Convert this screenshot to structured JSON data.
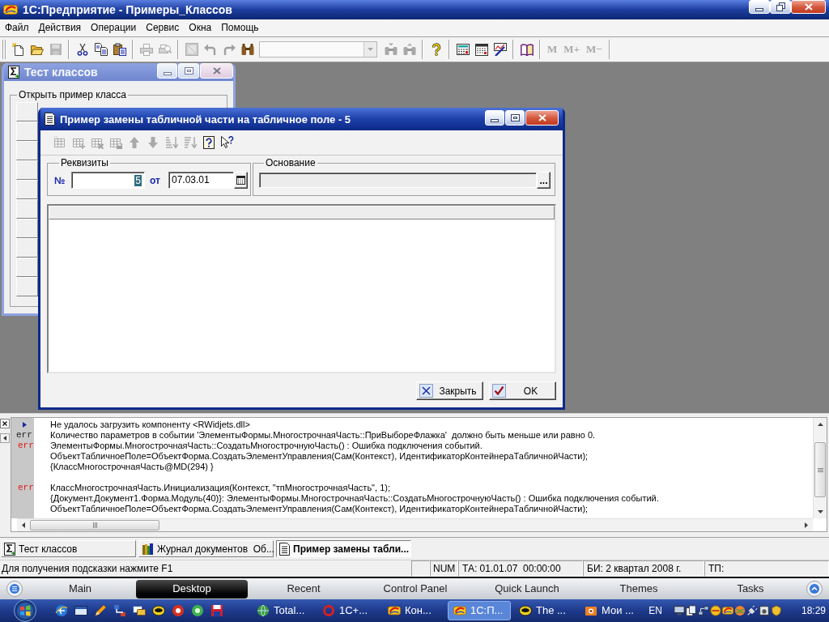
{
  "window": {
    "title": "1С:Предприятие - Примеры_Классов"
  },
  "menu": [
    "Файл",
    "Действия",
    "Операции",
    "Сервис",
    "Окна",
    "Помощь"
  ],
  "toolbar": [
    {
      "kind": "icon",
      "disabled": false
    },
    {
      "kind": "icon",
      "disabled": false
    },
    {
      "kind": "icon",
      "disabled": true
    },
    {
      "kind": "separator"
    },
    {
      "kind": "icon",
      "disabled": false
    },
    {
      "kind": "icon",
      "disabled": false
    },
    {
      "kind": "icon",
      "disabled": false
    },
    {
      "kind": "separator"
    },
    {
      "kind": "icon",
      "disabled": true
    },
    {
      "kind": "icon",
      "disabled": true
    },
    {
      "kind": "separator"
    },
    {
      "kind": "icon",
      "disabled": true
    },
    {
      "kind": "icon",
      "disabled": true
    },
    {
      "kind": "icon",
      "disabled": true
    },
    {
      "kind": "icon",
      "disabled": false
    },
    {
      "kind": "combo",
      "disabled": true
    },
    {
      "kind": "icon",
      "disabled": true
    },
    {
      "kind": "icon",
      "disabled": true
    },
    {
      "kind": "separator"
    },
    {
      "kind": "icon",
      "disabled": false
    },
    {
      "kind": "separator"
    },
    {
      "kind": "icon",
      "disabled": false
    },
    {
      "kind": "icon",
      "disabled": false
    },
    {
      "kind": "icon",
      "disabled": false
    },
    {
      "kind": "separator"
    },
    {
      "kind": "icon",
      "disabled": false
    },
    {
      "kind": "separator"
    },
    {
      "kind": "text",
      "label": "M",
      "disabled": true
    },
    {
      "kind": "text",
      "label": "M+",
      "disabled": true
    },
    {
      "kind": "text",
      "label": "M−",
      "disabled": true
    },
    {
      "kind": "separator"
    }
  ],
  "child_window": {
    "title": "Тест классов",
    "active": false,
    "group_title": "Открыть пример класса"
  },
  "dialog": {
    "title": "Пример замены табличной части на табличное поле - 5",
    "active": true,
    "toolbar": [
      {
        "disabled": true
      },
      {
        "disabled": true
      },
      {
        "disabled": true
      },
      {
        "disabled": true
      },
      {
        "disabled": true
      },
      {
        "disabled": true
      },
      {
        "disabled": true
      },
      {
        "disabled": true
      },
      {
        "disabled": false
      },
      {
        "disabled": false
      }
    ],
    "requisites": {
      "title": "Реквизиты",
      "number_label": "№",
      "number": "5",
      "number_selected": true,
      "date_label": "от",
      "date": "07.03.01"
    },
    "basis": {
      "title": "Основание",
      "button": "..."
    },
    "buttons": [
      {
        "kind": "close",
        "label": "Закрыть"
      },
      {
        "kind": "ok",
        "label": "OK"
      }
    ]
  },
  "messages": [
    {
      "lines": [
        {
          "kind": "info",
          "text": "Не удалось загрузить компоненту <RWidjets.dll>"
        },
        {
          "kind": "warning",
          "marker": "err",
          "text": "Количество параметров в событии 'ЭлементыФормы.МногострочнаяЧасть::ПриВыбореФлажка'  должно быть меньше или равно 0."
        },
        {
          "kind": "error",
          "marker": "err",
          "text": "ЭлементыФормы.МногострочнаяЧасть::СоздатьМногострочнуюЧасть() : Ошибка подключения событий."
        },
        {
          "kind": "text",
          "text": "ОбъектТабличноеПоле=ОбъектФорма.СоздатьЭлементУправления(Сам(Контекст), ИдентификаторКонтейнераТабличнойЧасти);"
        },
        {
          "kind": "text",
          "text": "{КлассМногострочнаяЧасть@MD(294) }"
        }
      ]
    },
    {
      "lines": [
        {
          "kind": "error",
          "marker": "err",
          "text": "КлассМногострочнаяЧасть.Инициализация(Контекст, \"тпМногострочнаяЧасть\", 1);"
        },
        {
          "kind": "text",
          "text": "{Документ.Документ1.Форма.Модуль(40)}: ЭлементыФормы.МногострочнаяЧасть::СоздатьМногострочнуюЧасть() : Ошибка подключения событий."
        },
        {
          "kind": "text",
          "text": "ОбъектТабличноеПоле=ОбъектФорма.СоздатьЭлементУправления(Сам(Контекст), ИдентификаторКонтейнераТабличнойЧасти);"
        }
      ]
    }
  ],
  "window_tabs": [
    {
      "kind": "processing",
      "label": "Тест классов",
      "selected": false
    },
    {
      "kind": "journal",
      "label": "Журнал документов  Об...",
      "selected": false
    },
    {
      "kind": "document",
      "label": "Пример замены табли...",
      "selected": true
    }
  ],
  "status_bar": {
    "hint": "Для получения подсказки нажмите F1",
    "panels": [
      "NUM",
      "ТА: 01.01.07  00:00:00",
      "БИ: 2 квартал 2008 г.",
      "ТП:"
    ]
  },
  "launcher": {
    "tabs": [
      {
        "label": "Main",
        "selected": false
      },
      {
        "label": "Desktop",
        "selected": true
      },
      {
        "label": "Recent",
        "selected": false
      },
      {
        "label": "Control Panel",
        "selected": false
      },
      {
        "label": "Quick Launch",
        "selected": false
      },
      {
        "label": "Themes",
        "selected": false
      },
      {
        "label": "Tasks",
        "selected": false
      }
    ]
  },
  "taskbar": {
    "tasks": [
      {
        "kind": "globe",
        "label": "Total...",
        "selected": false
      },
      {
        "kind": "ring",
        "label": "1С+...",
        "selected": false
      },
      {
        "kind": "logo",
        "label": "Кон...",
        "selected": false
      },
      {
        "kind": "logo",
        "label": "1С:П...",
        "selected": true
      },
      {
        "kind": "mask",
        "label": "The ...",
        "selected": false
      },
      {
        "kind": "picture",
        "label": "Мои ...",
        "selected": false
      }
    ],
    "language": "EN",
    "clock": "18:29"
  }
}
